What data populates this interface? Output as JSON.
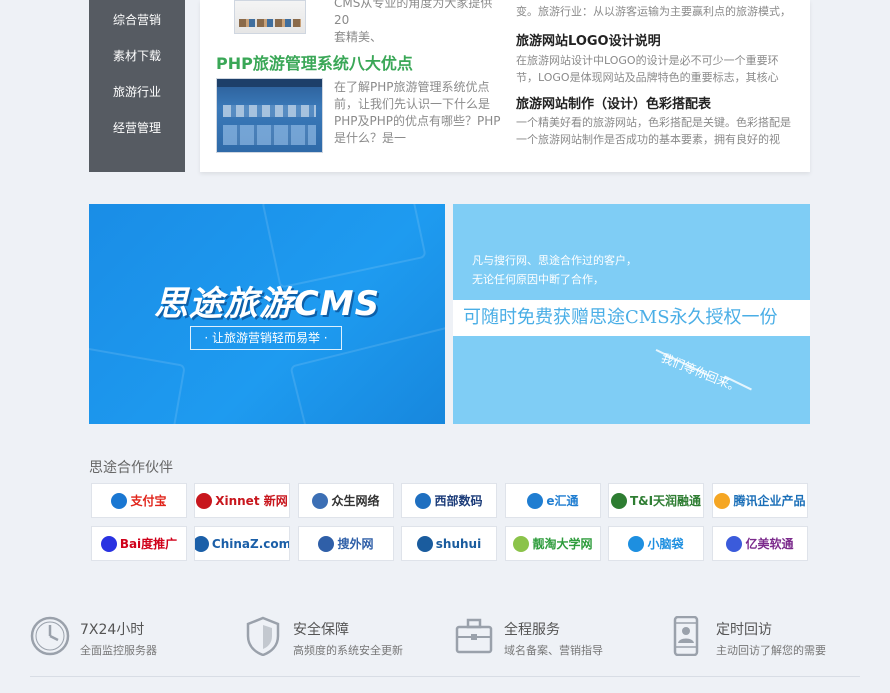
{
  "sidebar": {
    "items": [
      "综合营销",
      "素材下载",
      "旅游行业",
      "经营管理"
    ]
  },
  "articles": {
    "top_desc": [
      "CMS从专业的角度为大家提供20",
      "套精美、"
    ],
    "headline": "PHP旅游管理系统八大优点",
    "headline_desc": [
      "在了解PHP旅游管理系统优点",
      "前，让我们先认识一下什么是",
      "PHP及PHP的优点有哪些？PHP",
      "是什么？是一"
    ],
    "right_top_desc": "变。旅游行业：从以游客运输为主要赢利点的旅游模式，",
    "right": [
      {
        "title": "旅游网站LOGO设计说明",
        "desc": [
          "在旅游网站设计中LOGO的设计是必不可少一个重要环",
          "节，LOGO是体现网站及品牌特色的重要标志，其核心"
        ]
      },
      {
        "title": "旅游网站制作（设计）色彩搭配表",
        "desc": [
          "一个精美好看的旅游网站，色彩搭配是关键。色彩搭配是",
          "一个旅游网站制作是否成功的基本要素，拥有良好的视"
        ]
      }
    ]
  },
  "banner_left": {
    "logo": "思途旅游CMS",
    "slogan": "· 让旅游营销轻而易举 ·"
  },
  "banner_right": {
    "line1": "凡与搜行网、思途合作过的客户，",
    "line2": "无论任何原因中断了合作，",
    "highlight": "可随时免费获赠思途CMS永久授权一份",
    "wait": "我们等你回来。"
  },
  "partners": {
    "title": "思途合作伙伴",
    "logos": [
      {
        "name": "支付宝",
        "color": "#e1251b",
        "mark": "#1a77d2"
      },
      {
        "name": "Xinnet 新网",
        "color": "#c8161d",
        "mark": "#c8161d"
      },
      {
        "name": "众生网络",
        "color": "#333333",
        "mark": "#3c6fb5"
      },
      {
        "name": "西部数码",
        "color": "#1d3d7a",
        "mark": "#1f6fc0"
      },
      {
        "name": "e汇通",
        "color": "#1f7dd1",
        "mark": "#1f7dd1"
      },
      {
        "name": "T&I天润融通",
        "color": "#2e7d32",
        "mark": "#2e7d32"
      },
      {
        "name": "腾讯企业产品",
        "color": "#1b6fb8",
        "mark": "#f5a623"
      },
      {
        "name": "Bai度推广",
        "color": "#d0021b",
        "mark": "#2932e1"
      },
      {
        "name": "ChinaZ.com",
        "color": "#1b5fa8",
        "mark": "#1b5fa8"
      },
      {
        "name": "搜外网",
        "color": "#2f5fa8",
        "mark": "#2f5fa8"
      },
      {
        "name": "shuhui",
        "color": "#1a5c9e",
        "mark": "#1a5c9e"
      },
      {
        "name": "靓淘大学网",
        "color": "#2e9c3c",
        "mark": "#8bc34a"
      },
      {
        "name": "小脑袋",
        "color": "#1d8fe0",
        "mark": "#1d8fe0"
      },
      {
        "name": "亿美软通",
        "color": "#7b2a8c",
        "mark": "#3b5bdb"
      }
    ]
  },
  "features": [
    {
      "title": "7X24小时",
      "desc": "全面监控服务器",
      "icon": "clock-icon"
    },
    {
      "title": "安全保障",
      "desc": "高频度的系统安全更新",
      "icon": "shield-icon"
    },
    {
      "title": "全程服务",
      "desc": "域名备案、营销指导",
      "icon": "briefcase-icon"
    },
    {
      "title": "定时回访",
      "desc": "主动回访了解您的需要",
      "icon": "phone-user-icon"
    }
  ],
  "colors": {
    "sidebar_bg": "#565b62",
    "headline_green": "#3aa757",
    "banner_blue": "#1e9bf0",
    "banner_light_blue": "#7fcdf5"
  }
}
